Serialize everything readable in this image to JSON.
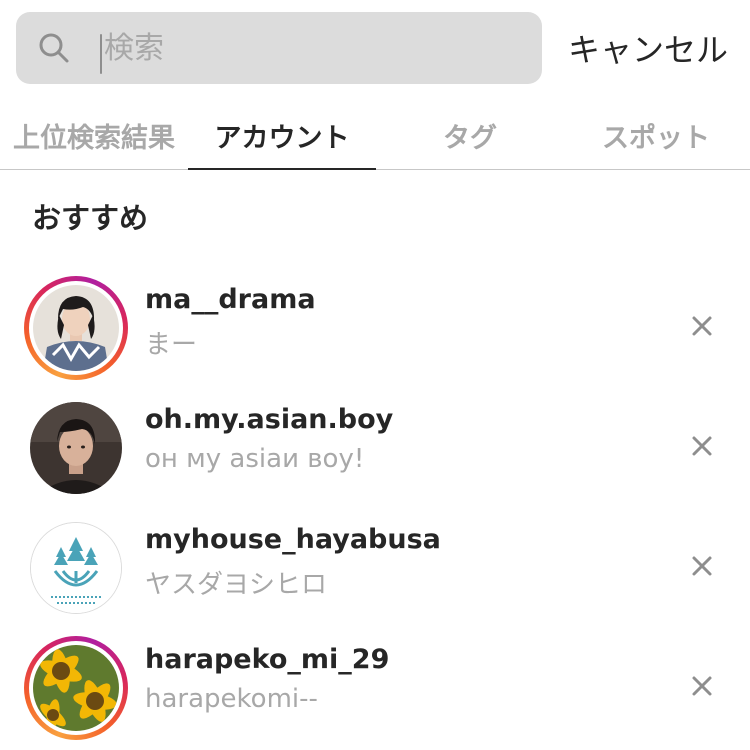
{
  "search": {
    "placeholder": "検索",
    "cancel_label": "キャンセル"
  },
  "tabs": [
    {
      "label": "上位検索結果",
      "active": false
    },
    {
      "label": "アカウント",
      "active": true
    },
    {
      "label": "タグ",
      "active": false
    },
    {
      "label": "スポット",
      "active": false
    }
  ],
  "section": {
    "title": "おすすめ"
  },
  "accounts": [
    {
      "username": "ma__drama",
      "name": "まー",
      "story_ring": true
    },
    {
      "username": "oh.my.asian.boy",
      "name": "он мy asiaи вoy!",
      "story_ring": false
    },
    {
      "username": "myhouse_hayabusa",
      "name": "ヤスダヨシヒロ",
      "story_ring": false
    },
    {
      "username": "harapeko_mi_29",
      "name": "harapekomi--",
      "story_ring": true
    }
  ],
  "colors": {
    "ring_start": "#f9a03f",
    "ring_mid": "#d8265c",
    "ring_end": "#b01fa0",
    "muted_text": "#a8a8a8",
    "primary_text": "#262626"
  }
}
